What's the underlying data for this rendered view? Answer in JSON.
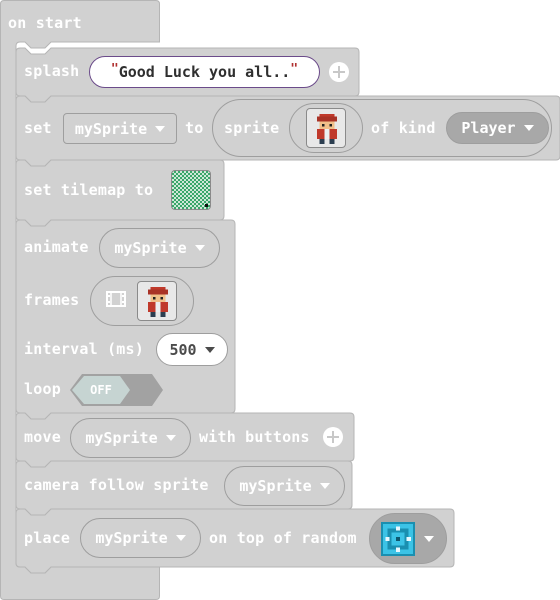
{
  "blocks": {
    "on_start": "on start",
    "splash": {
      "label": "splash",
      "quote_open": "\"",
      "text": "Good Luck you all..",
      "quote_close": "\""
    },
    "set_sprite": {
      "set": "set",
      "variable": "mySprite",
      "to": "to",
      "sprite": "sprite",
      "of_kind": "of kind",
      "kind": "Player"
    },
    "set_tilemap": {
      "label": "set tilemap to"
    },
    "animate": {
      "label": "animate",
      "variable": "mySprite",
      "frames": "frames",
      "interval": "interval (ms)",
      "interval_value": "500",
      "loop": "loop",
      "loop_value": "OFF"
    },
    "move": {
      "label": "move",
      "variable": "mySprite",
      "with_buttons": "with buttons"
    },
    "camera": {
      "label": "camera follow sprite",
      "variable": "mySprite"
    },
    "place": {
      "label": "place",
      "variable": "mySprite",
      "on_top": "on top of random"
    }
  },
  "colors": {
    "block_bg": "#d1d1d1",
    "block_border": "#b5b5b5",
    "toggle_off": "#a2a2a2"
  }
}
